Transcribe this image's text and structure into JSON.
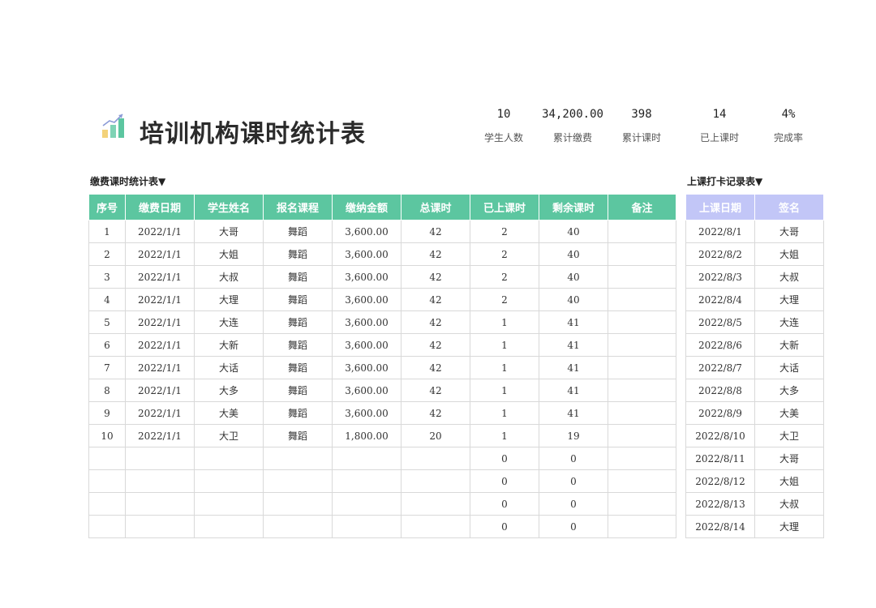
{
  "title": "培训机构课时统计表",
  "stats": [
    {
      "value": "10",
      "label": "学生人数"
    },
    {
      "value": "34,200.00",
      "label": "累计缴费"
    },
    {
      "value": "398",
      "label": "累计课时"
    },
    {
      "value": "14",
      "label": "已上课时"
    },
    {
      "value": "4%",
      "label": "完成率"
    }
  ],
  "main_section_label": "缴费课时统计表▼",
  "checkin_section_label": "上课打卡记录表▼",
  "main_table": {
    "headers": [
      "序号",
      "缴费日期",
      "学生姓名",
      "报名课程",
      "缴纳金额",
      "总课时",
      "已上课时",
      "剩余课时",
      "备注"
    ],
    "rows": [
      [
        "1",
        "2022/1/1",
        "大哥",
        "舞蹈",
        "3,600.00",
        "42",
        "2",
        "40",
        ""
      ],
      [
        "2",
        "2022/1/1",
        "大姐",
        "舞蹈",
        "3,600.00",
        "42",
        "2",
        "40",
        ""
      ],
      [
        "3",
        "2022/1/1",
        "大叔",
        "舞蹈",
        "3,600.00",
        "42",
        "2",
        "40",
        ""
      ],
      [
        "4",
        "2022/1/1",
        "大理",
        "舞蹈",
        "3,600.00",
        "42",
        "2",
        "40",
        ""
      ],
      [
        "5",
        "2022/1/1",
        "大连",
        "舞蹈",
        "3,600.00",
        "42",
        "1",
        "41",
        ""
      ],
      [
        "6",
        "2022/1/1",
        "大新",
        "舞蹈",
        "3,600.00",
        "42",
        "1",
        "41",
        ""
      ],
      [
        "7",
        "2022/1/1",
        "大话",
        "舞蹈",
        "3,600.00",
        "42",
        "1",
        "41",
        ""
      ],
      [
        "8",
        "2022/1/1",
        "大多",
        "舞蹈",
        "3,600.00",
        "42",
        "1",
        "41",
        ""
      ],
      [
        "9",
        "2022/1/1",
        "大美",
        "舞蹈",
        "3,600.00",
        "42",
        "1",
        "41",
        ""
      ],
      [
        "10",
        "2022/1/1",
        "大卫",
        "舞蹈",
        "1,800.00",
        "20",
        "1",
        "19",
        ""
      ],
      [
        "",
        "",
        "",
        "",
        "",
        "",
        "0",
        "0",
        ""
      ],
      [
        "",
        "",
        "",
        "",
        "",
        "",
        "0",
        "0",
        ""
      ],
      [
        "",
        "",
        "",
        "",
        "",
        "",
        "0",
        "0",
        ""
      ],
      [
        "",
        "",
        "",
        "",
        "",
        "",
        "0",
        "0",
        ""
      ]
    ]
  },
  "checkin_table": {
    "headers": [
      "上课日期",
      "签名"
    ],
    "rows": [
      [
        "2022/8/1",
        "大哥"
      ],
      [
        "2022/8/2",
        "大姐"
      ],
      [
        "2022/8/3",
        "大叔"
      ],
      [
        "2022/8/4",
        "大理"
      ],
      [
        "2022/8/5",
        "大连"
      ],
      [
        "2022/8/6",
        "大新"
      ],
      [
        "2022/8/7",
        "大话"
      ],
      [
        "2022/8/8",
        "大多"
      ],
      [
        "2022/8/9",
        "大美"
      ],
      [
        "2022/8/10",
        "大卫"
      ],
      [
        "2022/8/11",
        "大哥"
      ],
      [
        "2022/8/12",
        "大姐"
      ],
      [
        "2022/8/13",
        "大叔"
      ],
      [
        "2022/8/14",
        "大理"
      ]
    ]
  },
  "colors": {
    "main_header": "#5cc6a0",
    "checkin_header": "#c2c6f7"
  },
  "logo_icon": "bar-chart-growth-icon"
}
